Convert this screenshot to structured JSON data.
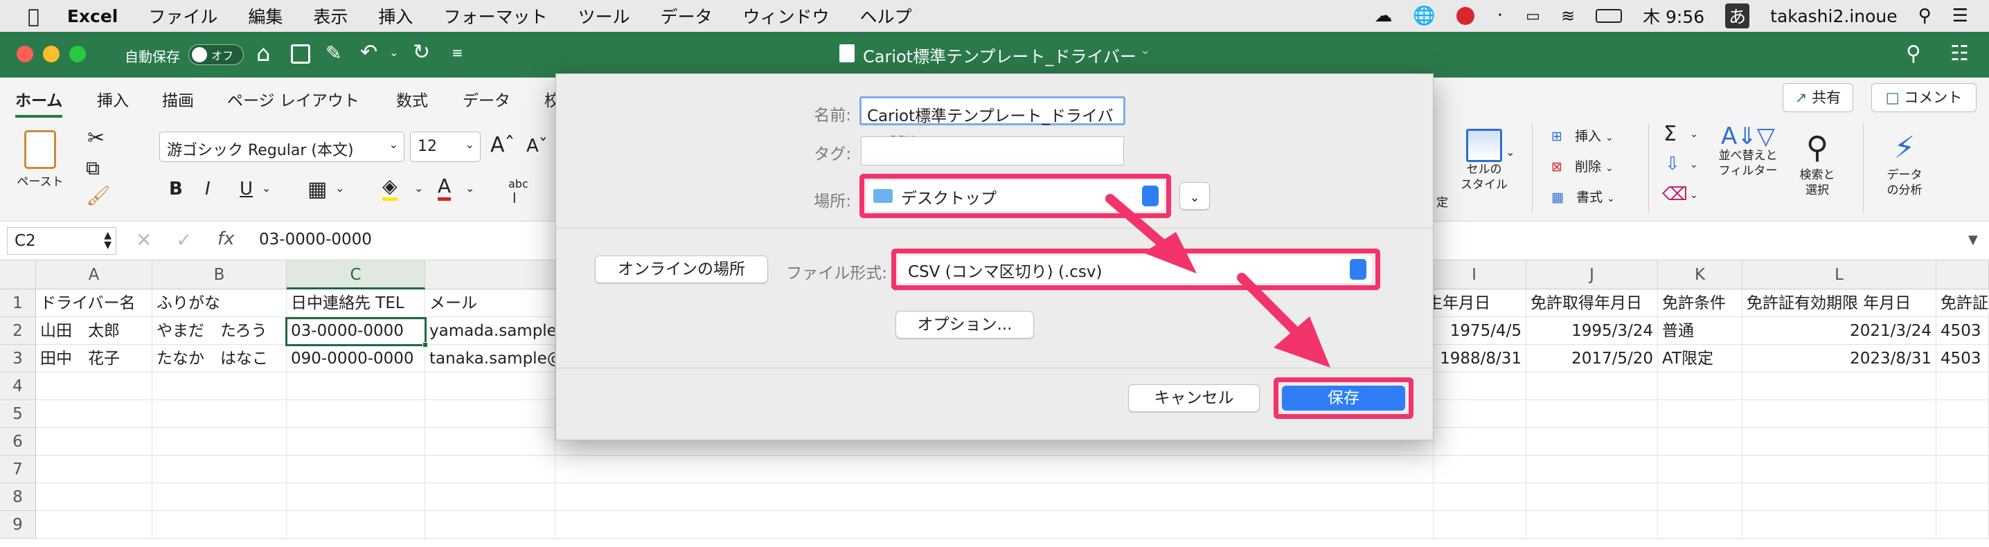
{
  "menubar": {
    "app": "Excel",
    "items": [
      "ファイル",
      "編集",
      "表示",
      "挿入",
      "フォーマット",
      "ツール",
      "データ",
      "ウィンドウ",
      "ヘルプ"
    ],
    "clock": "木 9:56",
    "input_mode": "あ",
    "user": "takashi2.inoue"
  },
  "titlebar": {
    "autosave": "自動保存",
    "toggle": "オフ",
    "doc_title": "Cariot標準テンプレート_ドライバー"
  },
  "ribbon": {
    "tabs": [
      "ホーム",
      "挿入",
      "描画",
      "ページ レイアウト",
      "数式",
      "データ",
      "校"
    ],
    "share": "共有",
    "comment": "コメント",
    "paste": "ペースト",
    "font": "游ゴシック Regular (本文)",
    "size": "12",
    "bold": "B",
    "italic": "I",
    "underline": "U",
    "abc": "abc",
    "style_l": "セルの",
    "style_l2": "スタイル",
    "cond_partial": "定",
    "insert": "挿入",
    "delete": "削除",
    "format": "書式",
    "sort1": "並べ替えと",
    "sort2": "フィルター",
    "find1": "検索と",
    "find2": "選択",
    "analyze1": "データ",
    "analyze2": "の分析"
  },
  "formula": {
    "cellref": "C2",
    "fx": "fx",
    "value": "03-0000-0000"
  },
  "grid": {
    "cols_left": [
      "A",
      "B",
      "C"
    ],
    "cols_right": [
      "I",
      "J",
      "K",
      "L"
    ],
    "headers_left": [
      "ドライバー名",
      "ふりがな",
      "日中連絡先 TEL",
      "メール"
    ],
    "headers_right": [
      "生年月日",
      "免許取得年月日",
      "免許条件",
      "免許証有効期限 年月日",
      "免許証"
    ],
    "rows": [
      {
        "n": "1"
      },
      {
        "n": "2",
        "a": "山田　太郎",
        "b": "やまだ　たろう",
        "c": "03-0000-0000",
        "d": "yamada.sample@",
        "i": "1975/4/5",
        "j": "1995/3/24",
        "k": "普通",
        "l": "2021/3/24",
        "m": "4503"
      },
      {
        "n": "3",
        "a": "田中　花子",
        "b": "たなか　はなこ",
        "c": "090-0000-0000",
        "d": "tanaka.sample@",
        "i": "1988/8/31",
        "j": "2017/5/20",
        "k": "AT限定",
        "l": "2023/8/31",
        "m": "4503"
      },
      {
        "n": "4"
      },
      {
        "n": "5"
      },
      {
        "n": "6"
      },
      {
        "n": "7"
      },
      {
        "n": "8"
      },
      {
        "n": "9"
      }
    ]
  },
  "dialog": {
    "name_label": "名前:",
    "name_value": "Cariot標準テンプレート_ドライバー.csv",
    "tag_label": "タグ:",
    "location_label": "場所:",
    "location_value": "デスクトップ",
    "online": "オンラインの場所",
    "format_label": "ファイル形式:",
    "format_value": "CSV (コンマ区切り) (.csv)",
    "options": "オプション...",
    "cancel": "キャンセル",
    "save": "保存"
  },
  "colors": {
    "excel_green": "#2b7a4b",
    "highlight": "#f2346b",
    "accent_blue": "#2f7ef6"
  }
}
